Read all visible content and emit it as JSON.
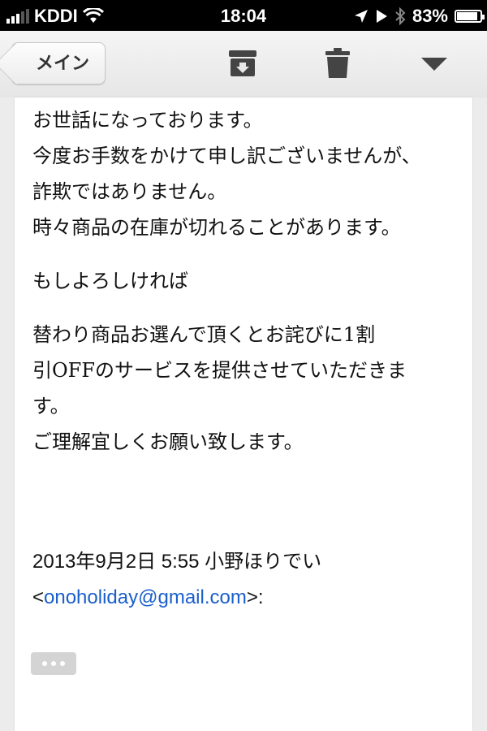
{
  "status_bar": {
    "carrier": "KDDI",
    "time": "18:04",
    "battery": "83%",
    "icons": [
      "signal-icon",
      "wifi-icon",
      "location-icon",
      "play-icon",
      "bluetooth-icon",
      "battery-icon"
    ]
  },
  "toolbar": {
    "back_label": "メイン",
    "icons": [
      "archive-icon",
      "trash-icon",
      "more-icon"
    ]
  },
  "email": {
    "body": [
      "お世話になっております。",
      "今度お手数をかけて申し訳ございませんが、",
      "詐欺ではありません。",
      "時々商品の在庫が切れることがあります。",
      "もしよろしければ",
      "替わり商品お選んで頂くとお詫びに1割",
      "引OFFのサービスを提供させていただきま",
      "す。",
      "ご理解宜しくお願い致します。"
    ],
    "quote_header": "2013年9月2日 5:55 小野ほりでい",
    "quote_email_open": "<",
    "quote_email": "onoholiday@gmail.com",
    "quote_email_close": ">:"
  },
  "colors": {
    "link": "#1a5fcc",
    "toolbar_icon": "#444444"
  }
}
